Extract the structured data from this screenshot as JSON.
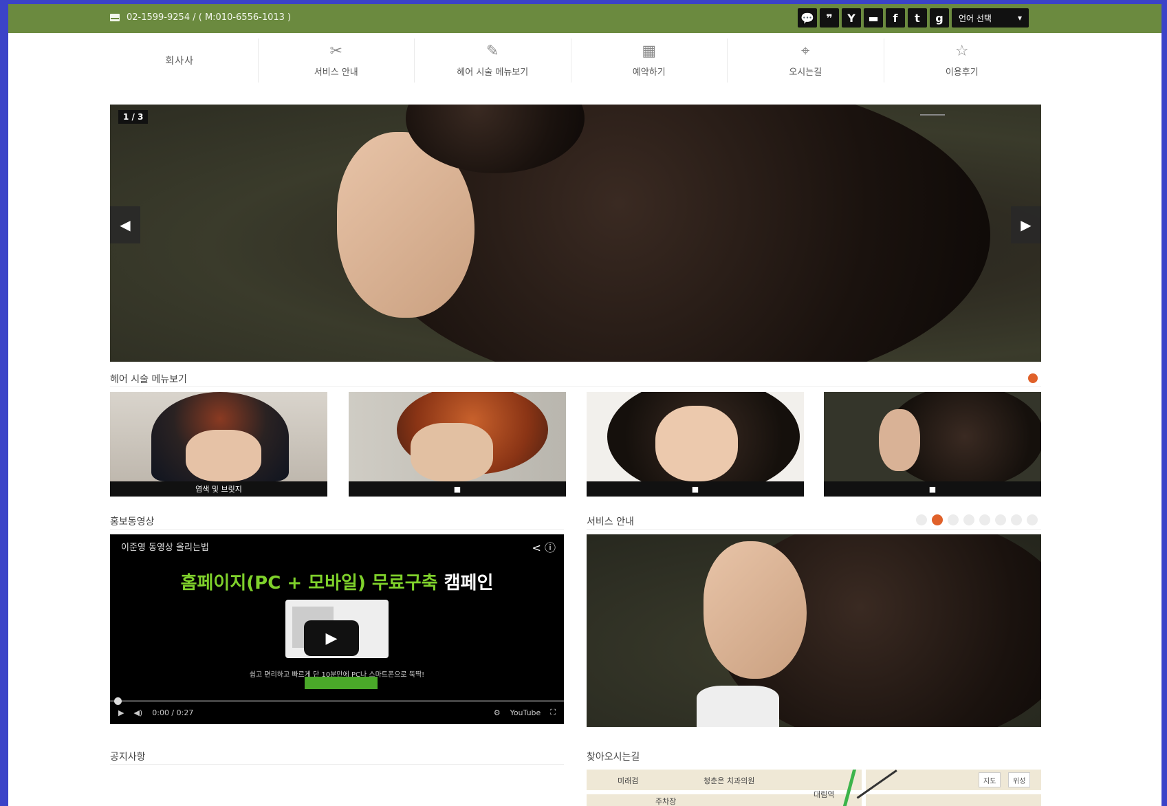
{
  "topbar": {
    "phone": "02-1599-9254 / ( M:010-6556-1013 )",
    "social": [
      {
        "icon": "kakaotalk-icon",
        "glyph": "💬"
      },
      {
        "icon": "kakaostory-icon",
        "glyph": "❞"
      },
      {
        "icon": "yozm-icon",
        "glyph": "Y"
      },
      {
        "icon": "band-icon",
        "glyph": "▬"
      },
      {
        "icon": "facebook-icon",
        "glyph": "f"
      },
      {
        "icon": "twitter-icon",
        "glyph": "t"
      },
      {
        "icon": "googleplus-icon",
        "glyph": "g"
      }
    ],
    "language_label": "언어 선택",
    "language_arrow": "▾"
  },
  "nav": {
    "logo": "회사사",
    "items": [
      {
        "label": "서비스 안내",
        "icon": "scissors-icon",
        "glyph": "✂"
      },
      {
        "label": "헤어 시술 메뉴보기",
        "icon": "brush-icon",
        "glyph": "✎"
      },
      {
        "label": "예약하기",
        "icon": "calendar-icon",
        "glyph": "▦"
      },
      {
        "label": "오시는길",
        "icon": "map-pin-icon",
        "glyph": "⌖"
      },
      {
        "label": "이용후기",
        "icon": "star-icon",
        "glyph": "☆"
      }
    ]
  },
  "hero": {
    "counter": "1 / 3",
    "prev": "◀",
    "next": "▶"
  },
  "menu_section": {
    "title": "헤어 시술 메뉴보기",
    "thumbs": [
      {
        "caption": "염색 및 브릿지"
      },
      {
        "caption": "■"
      },
      {
        "caption": "■"
      },
      {
        "caption": "■"
      }
    ]
  },
  "video_section": {
    "title": "홍보동영상",
    "video_title": "이준영 동영상 올리는법",
    "video_icons": "< ⓘ",
    "headline_green": "홈페이지(PC + 모바일) 무료구축",
    "headline_white": "캠페인",
    "subline": "쉽고 편리하고 빠르게 단 10분만에 PC나 스마트폰으로 뚝딱!",
    "play": "▶",
    "time": "0:00 / 0:27",
    "ctrl_play": "▶",
    "ctrl_volume": "◀)",
    "ctrl_settings": "⚙",
    "ctrl_youtube": "YouTube",
    "ctrl_fullscreen": "⛶"
  },
  "service_section": {
    "title": "서비스 안내",
    "dots": 8,
    "active_dot": 1
  },
  "notice_section": {
    "title": "공지사항"
  },
  "map_section": {
    "title": "찾아오시는길",
    "labels": [
      "미래검",
      "청춘은 치과의원",
      "주차장",
      "대림역"
    ],
    "btn_map": "지도",
    "btn_sat": "위성"
  },
  "colors": {
    "topbar_green": "#6b8a3f",
    "accent_orange": "#e0612a",
    "frame_blue": "#3b43c8"
  }
}
